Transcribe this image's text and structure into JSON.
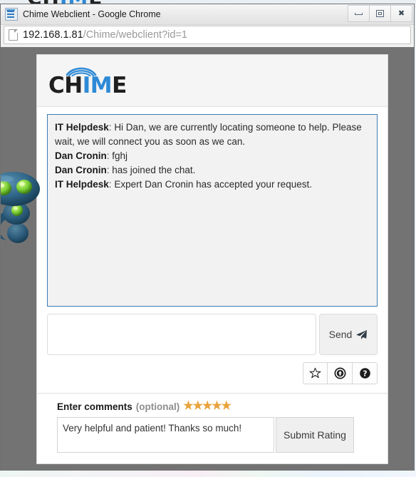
{
  "desktop": {
    "background_logo": {
      "prefix": "CH",
      "middle": "IM",
      "suffix": "E"
    }
  },
  "window": {
    "title": "Chime Webclient - Google Chrome",
    "favicon_name": "chime-favicon",
    "controls": {
      "minimize_label": "Minimize",
      "restore_label": "Restore",
      "close_label": "Close",
      "close_glyph": "✖"
    }
  },
  "address_bar": {
    "url_host": "192.168.1.81",
    "url_path": "/Chime/webclient?id=1",
    "page_icon_name": "page-icon"
  },
  "brand": {
    "logo_prefix": "CH",
    "logo_middle": "IM",
    "logo_suffix": "E",
    "accent_color": "#2e8ad6",
    "dark_color": "#1f1f1f"
  },
  "chat": {
    "border_color": "#3c7cb4",
    "messages": [
      {
        "sender": "IT Helpdesk",
        "separator": ":",
        "text": "Hi Dan, we are currently locating someone to help. Please wait, we will connect you as soon as we can."
      },
      {
        "sender": "Dan Cronin",
        "separator": ":",
        "text": "fghj"
      },
      {
        "sender": "Dan Cronin",
        "separator": ":",
        "text": "has joined the chat."
      },
      {
        "sender": "IT Helpdesk",
        "separator": ":",
        "text": "Expert Dan Cronin has accepted your request."
      }
    ]
  },
  "composer": {
    "message_value": "",
    "message_placeholder": "",
    "send_label": "Send",
    "send_icon_name": "paper-plane-icon"
  },
  "toolbar": {
    "buttons": [
      {
        "name": "favorite-button",
        "icon": "star-outline-icon"
      },
      {
        "name": "upload-button",
        "icon": "circle-up-arrow-icon"
      },
      {
        "name": "help-button",
        "icon": "circle-question-icon"
      }
    ]
  },
  "rating": {
    "label": "Enter comments",
    "optional_label": "(optional)",
    "stars_filled": 5,
    "stars_total": 5,
    "star_glyph": "★",
    "star_color": "#e8a33d",
    "comment_value": "Very helpful and patient! Thanks so much!",
    "comment_placeholder": "",
    "submit_label": "Submit Rating"
  },
  "mascot": {
    "name": "chime-robot-mascot",
    "body_color": "#2d5f80",
    "eye_color": "#7fd43a"
  }
}
